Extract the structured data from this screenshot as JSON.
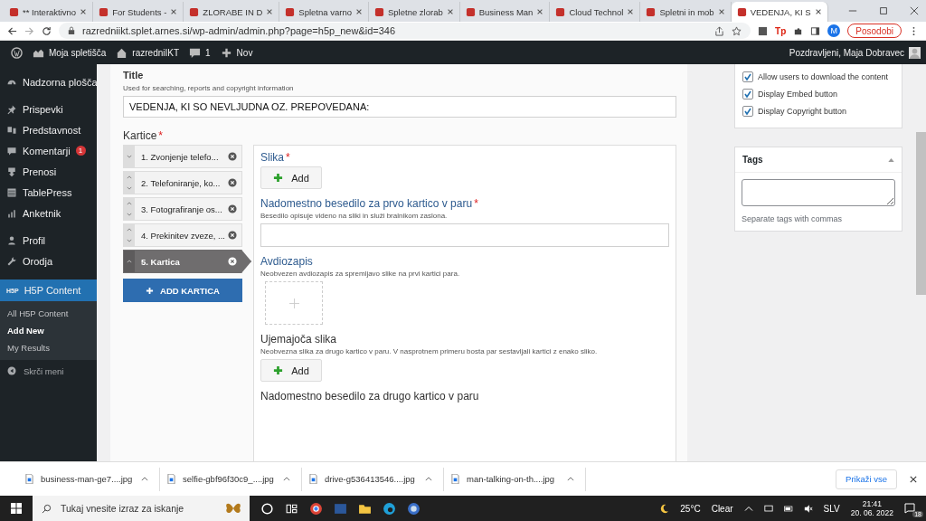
{
  "browser": {
    "tabs": [
      {
        "title": "** Interaktivno",
        "selected": false
      },
      {
        "title": "For Students -",
        "selected": false
      },
      {
        "title": "ZLORABE IN D",
        "selected": false
      },
      {
        "title": "Spletna varno",
        "selected": false
      },
      {
        "title": "Spletne zlorab",
        "selected": false
      },
      {
        "title": "Business Man",
        "selected": false
      },
      {
        "title": "Cloud Technol",
        "selected": false
      },
      {
        "title": "Spletni in mob",
        "selected": false
      },
      {
        "title": "VEDENJA, KI S",
        "selected": true
      }
    ],
    "url": "razredniikt.splet.arnes.si/wp-admin/admin.php?page=h5p_new&id=346",
    "extension_label": "Tp",
    "profile_initial": "M",
    "update_button": "Posodobi"
  },
  "admin_bar": {
    "site": "Moja spletišča",
    "home": "razredniIKT",
    "comments": "1",
    "new": "Nov",
    "greeting": "Pozdravljeni, Maja Dobravec"
  },
  "sidebar": {
    "groups": [
      [
        {
          "label": "Nadzorna plošča",
          "kind": "dashboard"
        }
      ],
      [
        {
          "label": "Prispevki",
          "kind": "pin"
        },
        {
          "label": "Predstavnost",
          "kind": "media"
        },
        {
          "label": "Komentarji",
          "kind": "comment",
          "badge": "1"
        },
        {
          "label": "Prenosi",
          "kind": "download"
        },
        {
          "label": "TablePress",
          "kind": "table"
        },
        {
          "label": "Anketnik",
          "kind": "chart"
        }
      ],
      [
        {
          "label": "Profil",
          "kind": "user"
        },
        {
          "label": "Orodja",
          "kind": "wrench"
        }
      ]
    ],
    "active": {
      "label": "H5P Content",
      "icon_label": "H5P",
      "submenu": [
        {
          "label": "All H5P Content",
          "selected": false
        },
        {
          "label": "Add New",
          "selected": true
        },
        {
          "label": "My Results",
          "selected": false
        }
      ]
    },
    "collapse": "Skrči meni"
  },
  "editor": {
    "title_label": "Title",
    "title_hint": "Used for searching, reports and copyright information",
    "title_value": "VEDENJA, KI SO NEVLJUDNA OZ. PREPOVEDANA:",
    "cards_label": "Kartice",
    "required_mark": "*",
    "cards": [
      {
        "label": "1. Zvonjenje telefo...",
        "selected": false
      },
      {
        "label": "2. Telefoniranje, ko...",
        "selected": false
      },
      {
        "label": "3. Fotografiranje os...",
        "selected": false
      },
      {
        "label": "4. Prekinitev zveze, ...",
        "selected": false
      },
      {
        "label": "5. Kartica",
        "selected": true
      }
    ],
    "add_card": "ADD KARTICA",
    "fields": [
      {
        "kind": "image",
        "label": "Slika",
        "required": true,
        "emphasized": true,
        "button": "Add"
      },
      {
        "kind": "text",
        "label": "Nadomestno besedilo za prvo kartico v paru",
        "required": true,
        "emphasized": true,
        "description": "Besedilo opisuje videno na sliki in služi bralnikom zaslona."
      },
      {
        "kind": "audio",
        "label": "Avdiozapis",
        "required": false,
        "emphasized": true,
        "description": "Neobvezen avdiozapis za spremljavo slike na prvi kartici para."
      },
      {
        "kind": "image",
        "label": "Ujemajoča slika",
        "required": false,
        "emphasized": false,
        "description": "Neobvezna slika za drugo kartico v paru. V nasprotnem primeru bosta par sestavljali kartici z enako sliko.",
        "button": "Add"
      },
      {
        "kind": "heading",
        "label": "Nadomestno besedilo za drugo kartico v paru",
        "required": false,
        "emphasized": false
      }
    ]
  },
  "display_options": [
    {
      "label": "Allow users to download the content",
      "checked": true
    },
    {
      "label": "Display Embed button",
      "checked": true
    },
    {
      "label": "Display Copyright button",
      "checked": true
    }
  ],
  "tags": {
    "title": "Tags",
    "hint": "Separate tags with commas"
  },
  "downloads": {
    "files": [
      "business-man-ge7....jpg",
      "selfie-gbf96f30c9_....jpg",
      "drive-g536413546....jpg",
      "man-talking-on-th....jpg"
    ],
    "show_all": "Prikaži vse"
  },
  "taskbar": {
    "search_placeholder": "Tukaj vnesite izraz za iskanje",
    "temperature": "25°C",
    "weather": "Clear",
    "language": "SLV",
    "time": "21:41",
    "date": "20. 06. 2022",
    "notifications": "18"
  }
}
